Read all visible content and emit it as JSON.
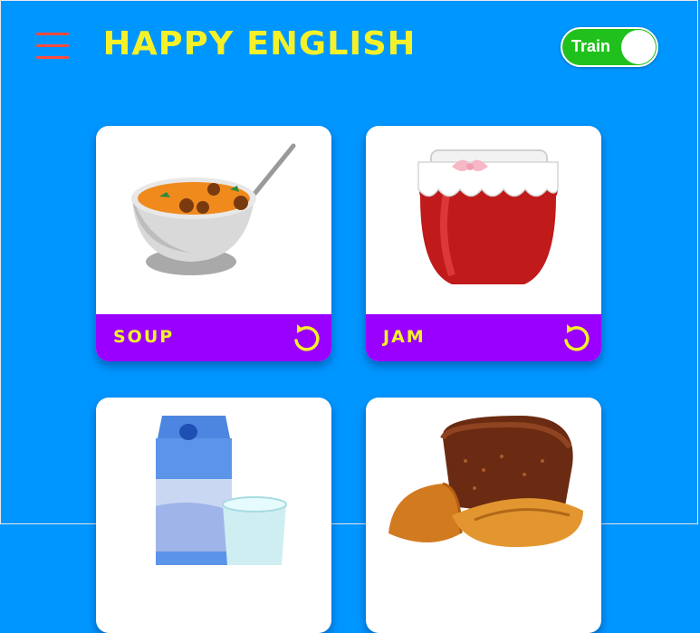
{
  "header": {
    "title": "HAPPY ENGLISH",
    "menu_icon": "hamburger-menu-icon",
    "toggle_label": "Train",
    "toggle_on": true
  },
  "colors": {
    "background": "#0096ff",
    "title": "#f4f12a",
    "card_bar": "#9900ff",
    "card_label": "#f4f12a",
    "menu_icon": "#ff4a3d",
    "toggle_on": "#21c11d"
  },
  "cards": [
    {
      "label": "SOUP",
      "image": "soup-bowl-image",
      "icon": "replay-icon"
    },
    {
      "label": "JAM",
      "image": "jam-jar-image",
      "icon": "replay-icon"
    },
    {
      "label": "",
      "image": "milk-carton-image"
    },
    {
      "label": "",
      "image": "bread-image"
    }
  ]
}
